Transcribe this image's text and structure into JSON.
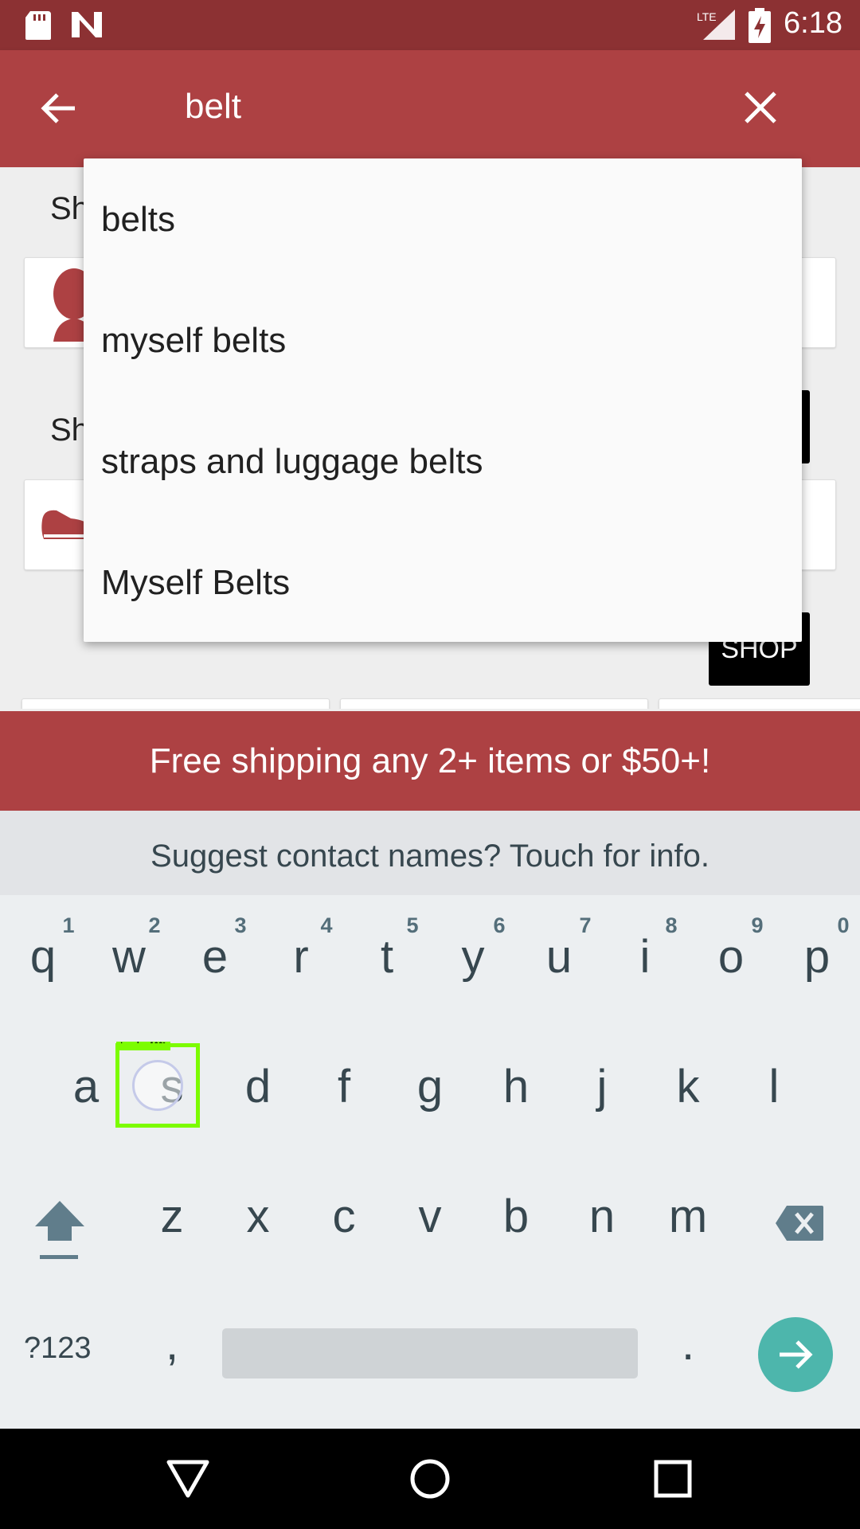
{
  "search": {
    "query": "belt"
  },
  "page": {
    "section_1_fragment": "Sh",
    "section_2_fragment": "Sh",
    "shop_button": "SHOP"
  },
  "suggestions": [
    "belts",
    "myself belts",
    "straps and luggage belts",
    "Myself Belts"
  ],
  "promo": {
    "text": "Free shipping any 2+ items or $50+!"
  },
  "keyboard": {
    "suggestion_strip": "Suggest contact names? Touch for info.",
    "row1": [
      "q",
      "w",
      "e",
      "r",
      "t",
      "y",
      "u",
      "i",
      "o",
      "p"
    ],
    "row1_hints": [
      "1",
      "2",
      "3",
      "4",
      "5",
      "6",
      "7",
      "8",
      "9",
      "0"
    ],
    "row2": [
      "a",
      "s",
      "d",
      "f",
      "g",
      "h",
      "j",
      "k",
      "l"
    ],
    "row3": [
      "z",
      "x",
      "c",
      "v",
      "b",
      "n",
      "m"
    ],
    "symbols_key": "?123",
    "comma_key": ",",
    "period_key": ".",
    "touch_label": "touch: 100%"
  },
  "status": {
    "time": "6:18",
    "network": "LTE"
  },
  "colors": {
    "status_bar": "#8c3133",
    "app_bar": "#ad4143",
    "accent": "#4db6ac"
  }
}
